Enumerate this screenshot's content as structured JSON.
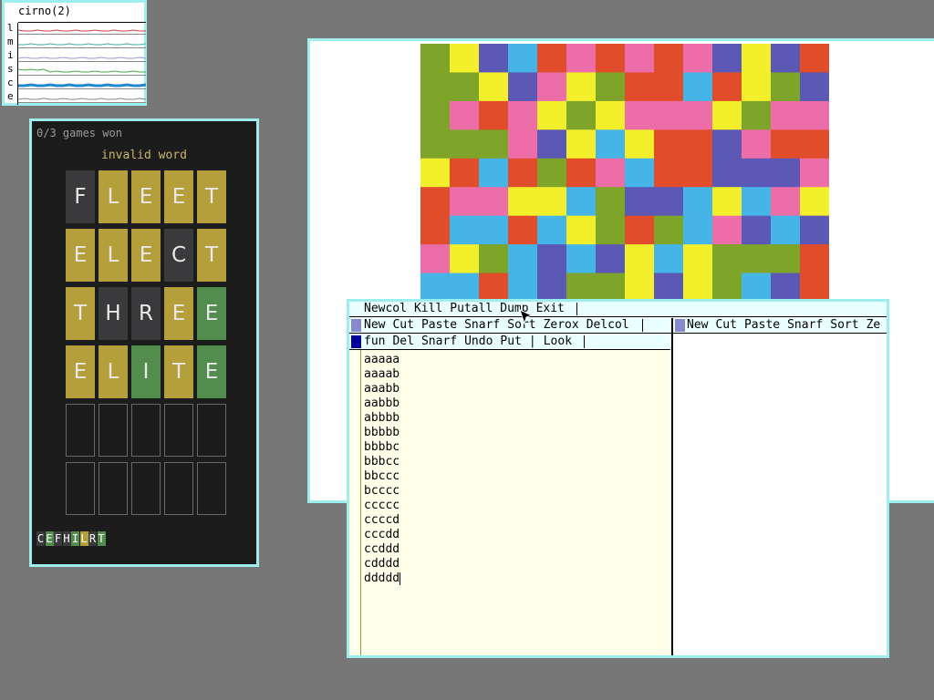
{
  "stats": {
    "title": "cirno(2)",
    "letters": [
      "l",
      "m",
      "i",
      "s",
      "c",
      "e"
    ],
    "graph_colors": [
      "#c44",
      "#4aa",
      "#99c",
      "#4a4",
      "#2288cc",
      "#888"
    ]
  },
  "wordle": {
    "status": "0/3 games won",
    "message": "invalid word",
    "rows": [
      [
        {
          "l": "F",
          "s": "absent"
        },
        {
          "l": "L",
          "s": "present"
        },
        {
          "l": "E",
          "s": "present"
        },
        {
          "l": "E",
          "s": "present"
        },
        {
          "l": "T",
          "s": "present"
        }
      ],
      [
        {
          "l": "E",
          "s": "present"
        },
        {
          "l": "L",
          "s": "present"
        },
        {
          "l": "E",
          "s": "present"
        },
        {
          "l": "C",
          "s": "absent"
        },
        {
          "l": "T",
          "s": "present"
        }
      ],
      [
        {
          "l": "T",
          "s": "present"
        },
        {
          "l": "H",
          "s": "absent"
        },
        {
          "l": "R",
          "s": "absent"
        },
        {
          "l": "E",
          "s": "present"
        },
        {
          "l": "E",
          "s": "correct"
        }
      ],
      [
        {
          "l": "E",
          "s": "present"
        },
        {
          "l": "L",
          "s": "present"
        },
        {
          "l": "I",
          "s": "correct"
        },
        {
          "l": "T",
          "s": "present"
        },
        {
          "l": "E",
          "s": "correct"
        }
      ],
      [
        {
          "l": "",
          "s": "empty"
        },
        {
          "l": "",
          "s": "empty"
        },
        {
          "l": "",
          "s": "empty"
        },
        {
          "l": "",
          "s": "empty"
        },
        {
          "l": "",
          "s": "empty"
        }
      ],
      [
        {
          "l": "",
          "s": "empty"
        },
        {
          "l": "",
          "s": "empty"
        },
        {
          "l": "",
          "s": "empty"
        },
        {
          "l": "",
          "s": "empty"
        },
        {
          "l": "",
          "s": "empty"
        }
      ]
    ],
    "keyboard": [
      {
        "l": "C",
        "s": "absent"
      },
      {
        "l": "E",
        "s": "correct"
      },
      {
        "l": "F",
        "s": "absent"
      },
      {
        "l": "H",
        "s": "absent"
      },
      {
        "l": "I",
        "s": "correct"
      },
      {
        "l": "L",
        "s": "present"
      },
      {
        "l": "R",
        "s": "absent"
      },
      {
        "l": "T",
        "s": "correct"
      }
    ],
    "colors": {
      "present": "#b59f3b",
      "correct": "#538d4e",
      "absent": "#3a3a3c"
    }
  },
  "mosaic": {
    "palette": {
      "G": "#7ea42a",
      "Y": "#f3ef2a",
      "B": "#5b58b6",
      "C": "#44b5e6",
      "R": "#e14d2a",
      "P": "#ec6da8"
    },
    "rows": [
      "GYBCRPRPRPBYBR",
      "GGYBPYGRRCRYGB",
      "GPRPYGYPPPYGPP",
      "GGGPBYCYRRBPRR",
      "YRCRGRPCRRBBBP",
      "RPPYYCGBBCYCPY",
      "RCCRCYGRGCPBCB",
      "PYGCBCBYCYGGGR",
      "CCRCBGGYBYGCBR"
    ]
  },
  "acme": {
    "column_tag": [
      "Newcol",
      "Kill",
      "Putall",
      "Dump",
      "Exit"
    ],
    "left_col_tag": [
      "New",
      "Cut",
      "Paste",
      "Snarf",
      "Sort",
      "Zerox",
      "Delcol"
    ],
    "right_col_tag": [
      "New",
      "Cut",
      "Paste",
      "Snarf",
      "Sort",
      "Ze"
    ],
    "window_tag": [
      "fun",
      "Del",
      "Snarf",
      "Undo",
      "Put",
      "|",
      "Look"
    ],
    "lines": [
      "aaaaa",
      "aaaab",
      "aaabb",
      "aabbb",
      "abbbb",
      "bbbbb",
      "bbbbc",
      "bbbcc",
      "bbccc",
      "bcccc",
      "ccccc",
      "ccccd",
      "cccdd",
      "ccddd",
      "cdddd",
      "ddddd"
    ]
  }
}
